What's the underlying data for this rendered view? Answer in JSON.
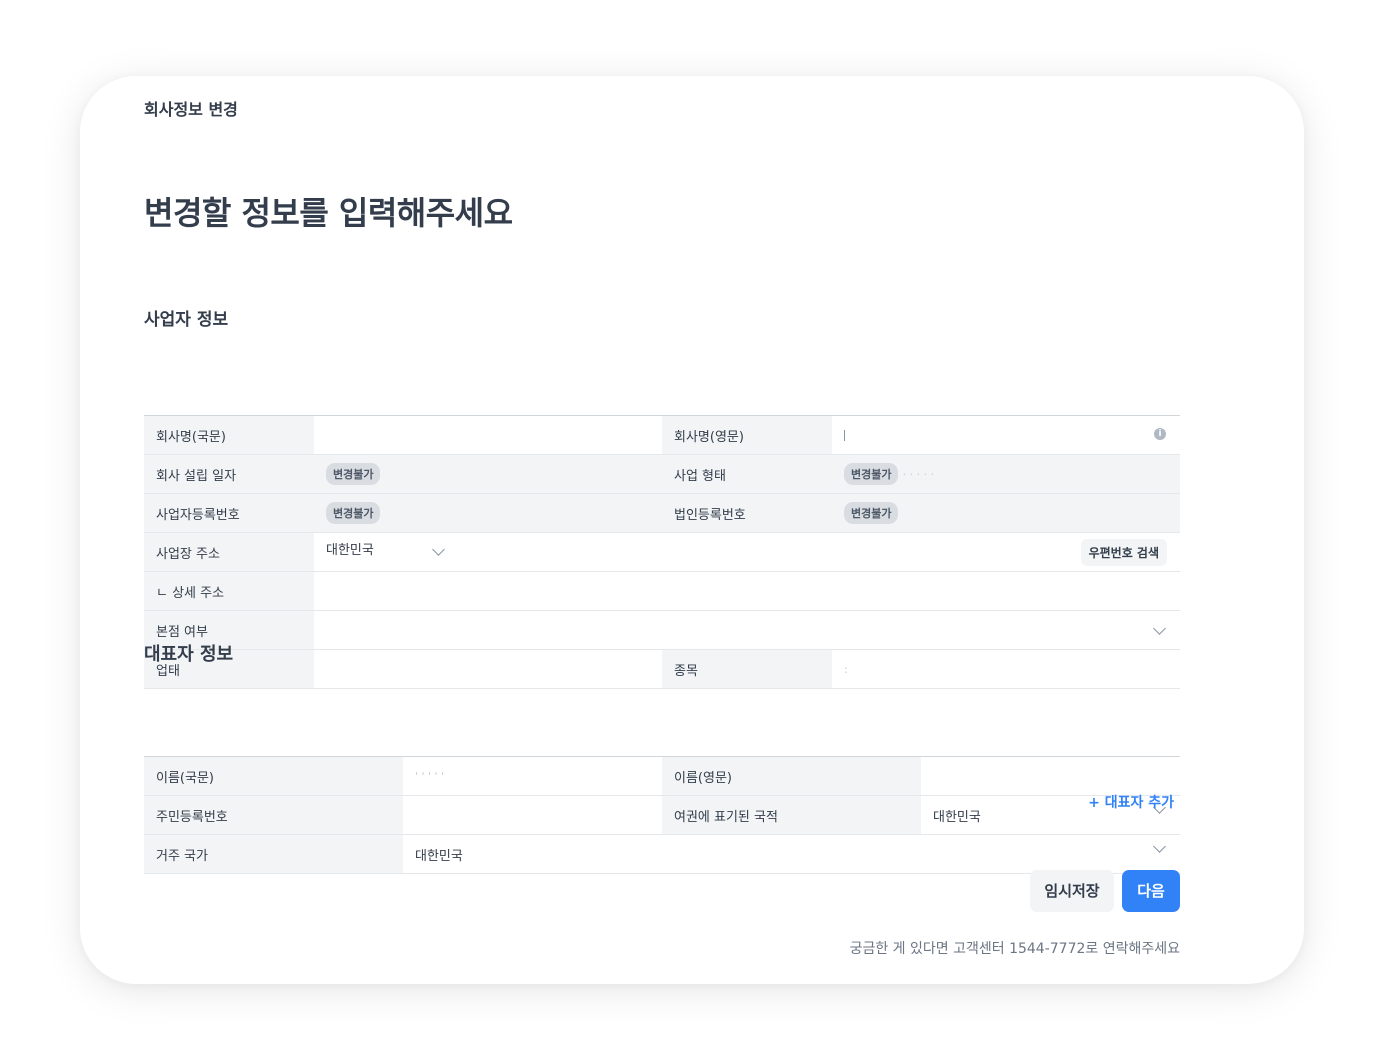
{
  "window_title": "회사정보 변경",
  "heading": "변경할 정보를 입력해주세요",
  "business_section": {
    "title": "사업자 정보",
    "rows": {
      "company_name_kr": {
        "label": "회사명(국문)",
        "value": ""
      },
      "company_name_en": {
        "label": "회사명(영문)",
        "value": ""
      },
      "founding_date": {
        "label": "회사 설립 일자",
        "badge": "변경불가"
      },
      "business_type": {
        "label": "사업 형태",
        "badge": "변경불가",
        "value": "· ·  ·  ·  ·"
      },
      "biz_reg_no": {
        "label": "사업자등록번호",
        "badge": "변경불가"
      },
      "corp_reg_no": {
        "label": "법인등록번호",
        "badge": "변경불가"
      },
      "address": {
        "label": "사업장 주소",
        "country": "대한민국",
        "zip_button": "우편번호 검색"
      },
      "address_detail": {
        "label": "ㄴ 상세 주소",
        "value": ""
      },
      "head_office": {
        "label": "본점 여부",
        "value": ""
      },
      "industry": {
        "label": "업태",
        "value": ""
      },
      "item": {
        "label": "종목",
        "value": ":"
      }
    }
  },
  "rep_section": {
    "title": "대표자 정보",
    "rows": {
      "name_kr": {
        "label": "이름(국문)",
        "value": "' ' ' '   '"
      },
      "name_en": {
        "label": "이름(영문)",
        "value": ""
      },
      "resident_no": {
        "label": "주민등록번호",
        "value": ""
      },
      "passport_country": {
        "label": "여권에 표기된 국적",
        "value": "대한민국"
      },
      "residence_country": {
        "label": "거주 국가",
        "value": "대한민국"
      }
    },
    "add_label": "+ 대표자 추가"
  },
  "buttons": {
    "save": "임시저장",
    "next": "다음"
  },
  "footer": "궁금한 게 있다면 고객센터 1544-7772로 연락해주세요",
  "colors": {
    "accent": "#3182f6",
    "label_bg": "#f2f4f6",
    "text": "#333d4b"
  }
}
